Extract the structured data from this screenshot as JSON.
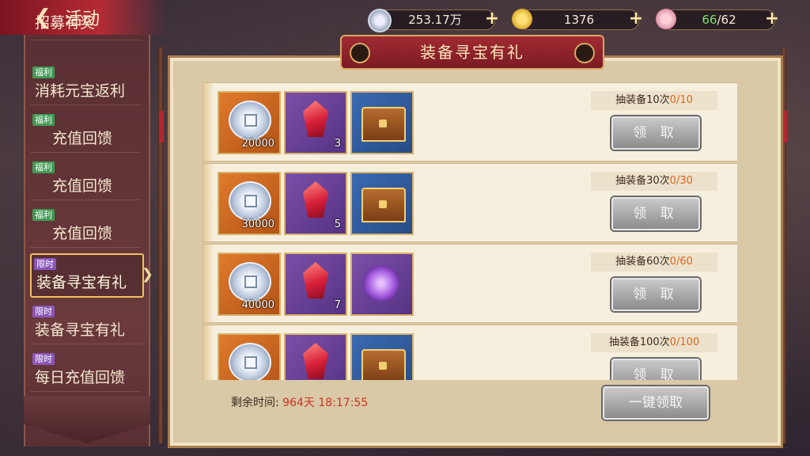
{
  "header": {
    "title": "活动",
    "back_icon": "back-arrow-icon",
    "resources": [
      {
        "name": "silver",
        "icon": "silver-coin-icon",
        "value": "253.17万"
      },
      {
        "name": "gold",
        "icon": "gold-ingot-icon",
        "value": "1376"
      },
      {
        "name": "stamina",
        "icon": "peach-icon",
        "current": "66",
        "max": "/62"
      }
    ]
  },
  "sidebar": {
    "partial_top_label": "招募有奖",
    "items": [
      {
        "tag": "福利",
        "label": "消耗元宝返利",
        "active": false
      },
      {
        "tag": "福利",
        "label": "充值回馈",
        "active": false
      },
      {
        "tag": "福利",
        "label": "充值回馈",
        "active": false
      },
      {
        "tag": "福利",
        "label": "充值回馈",
        "active": false
      },
      {
        "tag": "限时",
        "label": "装备寻宝有礼",
        "active": true
      },
      {
        "tag": "限时",
        "label": "装备寻宝有礼",
        "active": false
      },
      {
        "tag": "限时",
        "label": "每日充值回馈",
        "active": false
      }
    ]
  },
  "panel": {
    "title": "装备寻宝有礼",
    "rows": [
      {
        "rewards": [
          {
            "type": "silver",
            "qty": "20000"
          },
          {
            "type": "red-gem",
            "qty": "3"
          },
          {
            "type": "chest",
            "qty": ""
          }
        ],
        "condition": "抽装备10次",
        "progress": "0/10",
        "button": "领 取"
      },
      {
        "rewards": [
          {
            "type": "silver",
            "qty": "30000"
          },
          {
            "type": "red-gem",
            "qty": "5"
          },
          {
            "type": "chest",
            "qty": ""
          }
        ],
        "condition": "抽装备30次",
        "progress": "0/30",
        "button": "领 取"
      },
      {
        "rewards": [
          {
            "type": "silver",
            "qty": "40000"
          },
          {
            "type": "red-gem",
            "qty": "7"
          },
          {
            "type": "purple-orb",
            "qty": ""
          }
        ],
        "condition": "抽装备60次",
        "progress": "0/60",
        "button": "领 取"
      },
      {
        "rewards": [
          {
            "type": "silver",
            "qty": ""
          },
          {
            "type": "red-gem",
            "qty": ""
          },
          {
            "type": "chest",
            "qty": ""
          }
        ],
        "condition": "抽装备100次",
        "progress": "0/100",
        "button": "领 取"
      }
    ],
    "footer": {
      "time_label": "剩余时间:",
      "time_value": "964天 18:17:55",
      "claim_all": "一键领取"
    }
  },
  "colors": {
    "accent_red": "#a12a32",
    "progress_orange": "#e0641c",
    "time_red": "#d03020",
    "tag_welfare": "#3f9a52",
    "tag_limited": "#8a55b8"
  }
}
